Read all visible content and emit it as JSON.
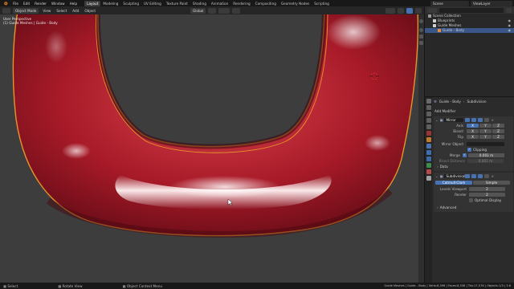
{
  "menu": {
    "items": [
      "File",
      "Edit",
      "Render",
      "Window",
      "Help"
    ],
    "workspaces": [
      "Layout",
      "Modeling",
      "Sculpting",
      "UV Editing",
      "Texture Paint",
      "Shading",
      "Animation",
      "Rendering",
      "Compositing",
      "Geometry Nodes",
      "Scripting"
    ],
    "active_workspace": "Layout",
    "scene_label": "Scene",
    "view_layer_label": "ViewLayer"
  },
  "viewport_header": {
    "mode": "Object Mode",
    "menus": [
      "View",
      "Select",
      "Add",
      "Object"
    ],
    "orientation": "Global"
  },
  "viewport": {
    "view_name": "User Perspective",
    "object_info": "(1) Guide Meshes | Guide - Body"
  },
  "outliner": {
    "rows": [
      {
        "label": "Scene Collection",
        "indent": 0,
        "color": "#9a9a9a",
        "selected": false
      },
      {
        "label": "Blueprints",
        "indent": 1,
        "color": "#d0d0d0",
        "selected": false
      },
      {
        "label": "Guide Meshes",
        "indent": 1,
        "color": "#d0d0d0",
        "selected": false
      },
      {
        "label": "Guide - Body",
        "indent": 2,
        "color": "#e58a3a",
        "selected": true
      }
    ]
  },
  "properties": {
    "object_name": "Guide - Body",
    "modifier_title": "Subdivision",
    "add_modifier": "Add Modifier",
    "mirror": {
      "name": "Mirror",
      "axis_label": "Axis",
      "bisect_label": "Bisect",
      "flip_label": "Flip",
      "axes": [
        "X",
        "Y",
        "Z"
      ],
      "mirror_object_label": "Mirror Object",
      "clipping_label": "Clipping",
      "merge_label": "Merge",
      "merge_value": "0.001 m",
      "bisect_distance_label": "Bisect Distance",
      "bisect_distance_value": "0.001 m",
      "data_label": "Data"
    },
    "subdivision": {
      "name": "Subdivision",
      "mode_a": "Catmull-Clark",
      "mode_b": "Simple",
      "levels_viewport_label": "Levels Viewport",
      "levels_viewport_value": "2",
      "render_label": "Render",
      "render_value": "2",
      "optimal_display_label": "Optimal Display",
      "advanced_label": "Advanced"
    }
  },
  "status": {
    "select": "Select",
    "rotate": "Rotate View",
    "context": "Object Context Menu",
    "stats": "Guide Meshes | Guide - Body | Verts:8,596 | Faces:8,538 | Tris:17,076 | Objects:1/3 | 3.6"
  },
  "colors": {
    "accent_blue": "#4772b3",
    "selection_orange": "#e8932a",
    "mesh_red": "#b3202e"
  }
}
